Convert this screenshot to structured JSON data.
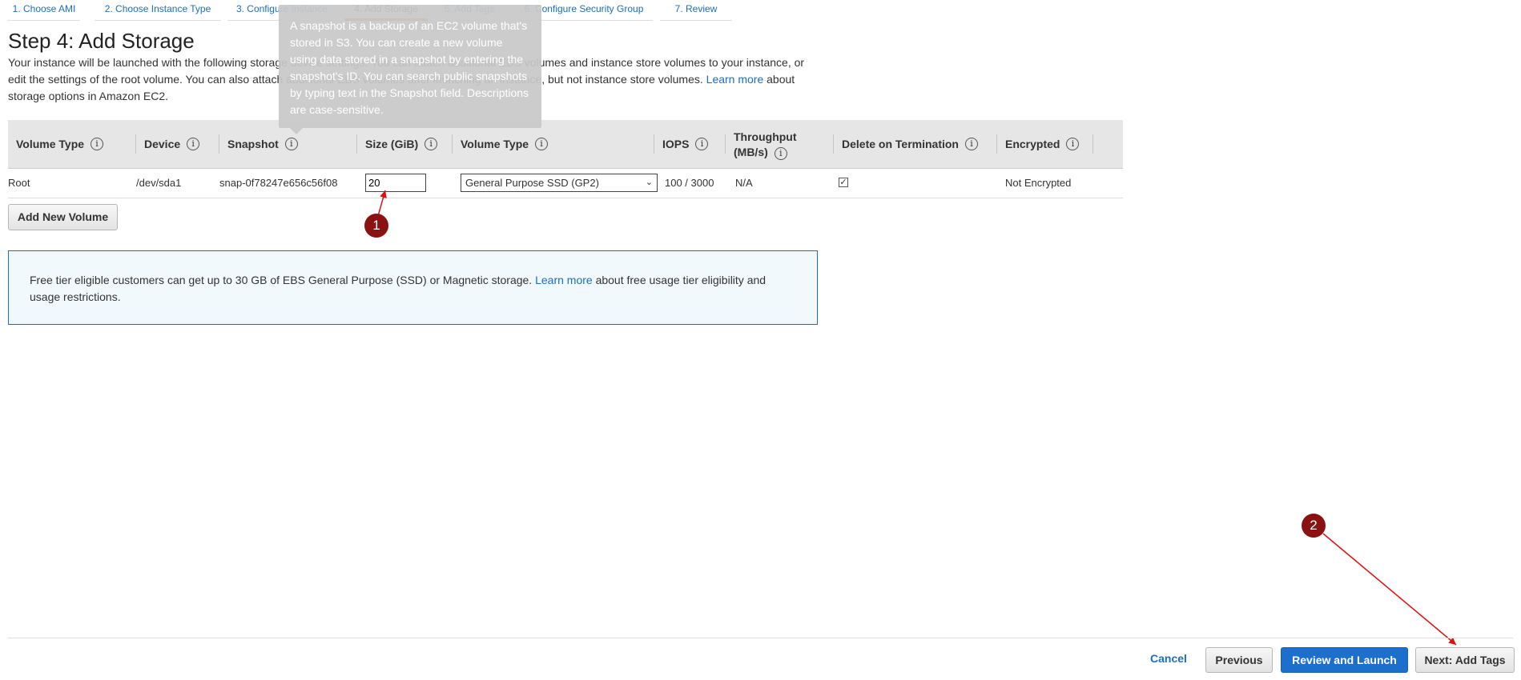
{
  "wizard": {
    "steps": [
      {
        "label": "1. Choose AMI"
      },
      {
        "label": "2. Choose Instance Type"
      },
      {
        "label": "3. Configure Instance"
      },
      {
        "label": "4. Add Storage"
      },
      {
        "label": "5. Add Tags"
      },
      {
        "label": "6. Configure Security Group"
      },
      {
        "label": "7. Review"
      }
    ]
  },
  "page": {
    "title": "Step 4: Add Storage",
    "description_before_link": "Your instance will be launched with the following storage device settings. You can attach additional EBS volumes and instance store volumes to your instance, or edit the settings of the root volume. You can also attach additional EBS volumes after launching an instance, but not instance store volumes.",
    "learn_more": "Learn more",
    "description_after_link": "about storage options in Amazon EC2."
  },
  "tooltip": {
    "text": "A snapshot is a backup of an EC2 volume that's stored in S3. You can create a new volume using data stored in a snapshot by entering the snapshot's ID. You can search public snapshots by typing text in the Snapshot field. Descriptions are case-sensitive."
  },
  "table": {
    "columns": [
      "Volume Type",
      "Device",
      "Snapshot",
      "Size (GiB)",
      "Volume Type",
      "IOPS",
      "Throughput",
      "(MB/s)",
      "Delete on Termination",
      "Encrypted"
    ],
    "info_icon": "i",
    "row": {
      "volume_type": "Root",
      "device": "/dev/sda1",
      "snapshot": "snap-0f78247e656c56f08",
      "size": "20",
      "volume_type_select": "General Purpose SSD (GP2)",
      "iops": "100 / 3000",
      "throughput": "N/A",
      "delete_on_termination": true,
      "encrypted": "Not Encrypted"
    }
  },
  "add_volume_label": "Add New Volume",
  "free_tier": {
    "text_before": "Free tier eligible customers can get up to 30 GB of EBS General Purpose (SSD) or Magnetic storage.",
    "learn_more": "Learn more",
    "text_after": "about free usage tier eligibility and usage restrictions."
  },
  "markers": {
    "one": "1",
    "two": "2"
  },
  "footer": {
    "cancel": "Cancel",
    "previous": "Previous",
    "review_launch": "Review and Launch",
    "next": "Next: Add Tags"
  },
  "colors": {
    "accent": "#1d6fcd",
    "active_step": "#e07b1f",
    "marker": "#8b1212",
    "callout_bg": "#f1f9fd"
  }
}
